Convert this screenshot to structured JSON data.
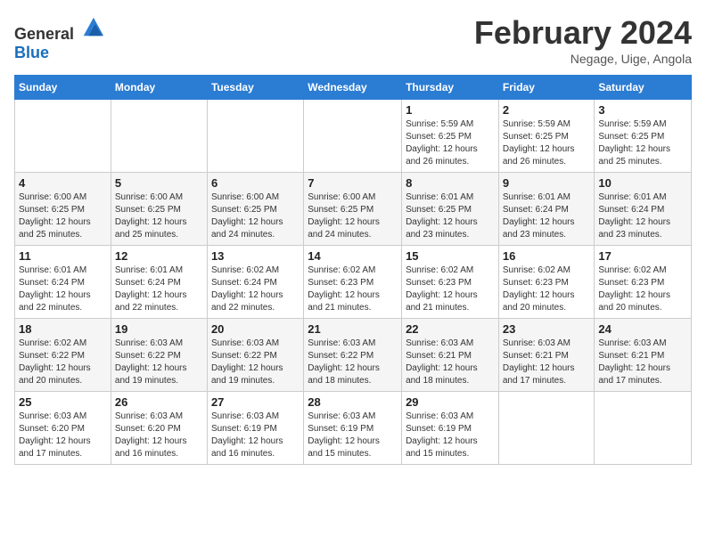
{
  "header": {
    "logo_general": "General",
    "logo_blue": "Blue",
    "title": "February 2024",
    "subtitle": "Negage, Uige, Angola"
  },
  "days_of_week": [
    "Sunday",
    "Monday",
    "Tuesday",
    "Wednesday",
    "Thursday",
    "Friday",
    "Saturday"
  ],
  "weeks": [
    [
      {
        "num": "",
        "info": ""
      },
      {
        "num": "",
        "info": ""
      },
      {
        "num": "",
        "info": ""
      },
      {
        "num": "",
        "info": ""
      },
      {
        "num": "1",
        "info": "Sunrise: 5:59 AM\nSunset: 6:25 PM\nDaylight: 12 hours\nand 26 minutes."
      },
      {
        "num": "2",
        "info": "Sunrise: 5:59 AM\nSunset: 6:25 PM\nDaylight: 12 hours\nand 26 minutes."
      },
      {
        "num": "3",
        "info": "Sunrise: 5:59 AM\nSunset: 6:25 PM\nDaylight: 12 hours\nand 25 minutes."
      }
    ],
    [
      {
        "num": "4",
        "info": "Sunrise: 6:00 AM\nSunset: 6:25 PM\nDaylight: 12 hours\nand 25 minutes."
      },
      {
        "num": "5",
        "info": "Sunrise: 6:00 AM\nSunset: 6:25 PM\nDaylight: 12 hours\nand 25 minutes."
      },
      {
        "num": "6",
        "info": "Sunrise: 6:00 AM\nSunset: 6:25 PM\nDaylight: 12 hours\nand 24 minutes."
      },
      {
        "num": "7",
        "info": "Sunrise: 6:00 AM\nSunset: 6:25 PM\nDaylight: 12 hours\nand 24 minutes."
      },
      {
        "num": "8",
        "info": "Sunrise: 6:01 AM\nSunset: 6:25 PM\nDaylight: 12 hours\nand 23 minutes."
      },
      {
        "num": "9",
        "info": "Sunrise: 6:01 AM\nSunset: 6:24 PM\nDaylight: 12 hours\nand 23 minutes."
      },
      {
        "num": "10",
        "info": "Sunrise: 6:01 AM\nSunset: 6:24 PM\nDaylight: 12 hours\nand 23 minutes."
      }
    ],
    [
      {
        "num": "11",
        "info": "Sunrise: 6:01 AM\nSunset: 6:24 PM\nDaylight: 12 hours\nand 22 minutes."
      },
      {
        "num": "12",
        "info": "Sunrise: 6:01 AM\nSunset: 6:24 PM\nDaylight: 12 hours\nand 22 minutes."
      },
      {
        "num": "13",
        "info": "Sunrise: 6:02 AM\nSunset: 6:24 PM\nDaylight: 12 hours\nand 22 minutes."
      },
      {
        "num": "14",
        "info": "Sunrise: 6:02 AM\nSunset: 6:23 PM\nDaylight: 12 hours\nand 21 minutes."
      },
      {
        "num": "15",
        "info": "Sunrise: 6:02 AM\nSunset: 6:23 PM\nDaylight: 12 hours\nand 21 minutes."
      },
      {
        "num": "16",
        "info": "Sunrise: 6:02 AM\nSunset: 6:23 PM\nDaylight: 12 hours\nand 20 minutes."
      },
      {
        "num": "17",
        "info": "Sunrise: 6:02 AM\nSunset: 6:23 PM\nDaylight: 12 hours\nand 20 minutes."
      }
    ],
    [
      {
        "num": "18",
        "info": "Sunrise: 6:02 AM\nSunset: 6:22 PM\nDaylight: 12 hours\nand 20 minutes."
      },
      {
        "num": "19",
        "info": "Sunrise: 6:03 AM\nSunset: 6:22 PM\nDaylight: 12 hours\nand 19 minutes."
      },
      {
        "num": "20",
        "info": "Sunrise: 6:03 AM\nSunset: 6:22 PM\nDaylight: 12 hours\nand 19 minutes."
      },
      {
        "num": "21",
        "info": "Sunrise: 6:03 AM\nSunset: 6:22 PM\nDaylight: 12 hours\nand 18 minutes."
      },
      {
        "num": "22",
        "info": "Sunrise: 6:03 AM\nSunset: 6:21 PM\nDaylight: 12 hours\nand 18 minutes."
      },
      {
        "num": "23",
        "info": "Sunrise: 6:03 AM\nSunset: 6:21 PM\nDaylight: 12 hours\nand 17 minutes."
      },
      {
        "num": "24",
        "info": "Sunrise: 6:03 AM\nSunset: 6:21 PM\nDaylight: 12 hours\nand 17 minutes."
      }
    ],
    [
      {
        "num": "25",
        "info": "Sunrise: 6:03 AM\nSunset: 6:20 PM\nDaylight: 12 hours\nand 17 minutes."
      },
      {
        "num": "26",
        "info": "Sunrise: 6:03 AM\nSunset: 6:20 PM\nDaylight: 12 hours\nand 16 minutes."
      },
      {
        "num": "27",
        "info": "Sunrise: 6:03 AM\nSunset: 6:19 PM\nDaylight: 12 hours\nand 16 minutes."
      },
      {
        "num": "28",
        "info": "Sunrise: 6:03 AM\nSunset: 6:19 PM\nDaylight: 12 hours\nand 15 minutes."
      },
      {
        "num": "29",
        "info": "Sunrise: 6:03 AM\nSunset: 6:19 PM\nDaylight: 12 hours\nand 15 minutes."
      },
      {
        "num": "",
        "info": ""
      },
      {
        "num": "",
        "info": ""
      }
    ]
  ]
}
